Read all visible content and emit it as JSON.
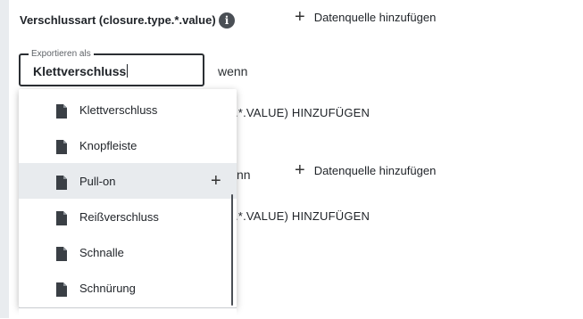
{
  "field": {
    "title": "Verschlussart (closure.type.*.value)",
    "info_icon": "info-icon"
  },
  "add_source_label": "Datenquelle hinzufügen",
  "export_input": {
    "legend": "Exportieren als",
    "value": "Klettverschluss"
  },
  "wenn_label": "wenn",
  "partial_texts": {
    "row1_wenn_suffix": "nn",
    "hinzufuegen_1": ".*.VALUE) HINZUFÜGEN",
    "hinzufuegen_2": ".*.VALUE) HINZUFÜGEN"
  },
  "dropdown": {
    "items": [
      {
        "label": "Klettverschluss",
        "icon": "document-icon"
      },
      {
        "label": "Knopfleiste",
        "icon": "document-icon"
      },
      {
        "label": "Pull-on",
        "icon": "document-icon",
        "hovered": true,
        "action_icon": "plus-icon"
      },
      {
        "label": "Reißverschluss",
        "icon": "document-icon"
      },
      {
        "label": "Schnalle",
        "icon": "document-icon"
      },
      {
        "label": "Schnürung",
        "icon": "document-icon"
      }
    ]
  },
  "colors": {
    "hover_bg": "#e8ebee",
    "rail": "#e9ecef",
    "text": "#1f2328"
  }
}
